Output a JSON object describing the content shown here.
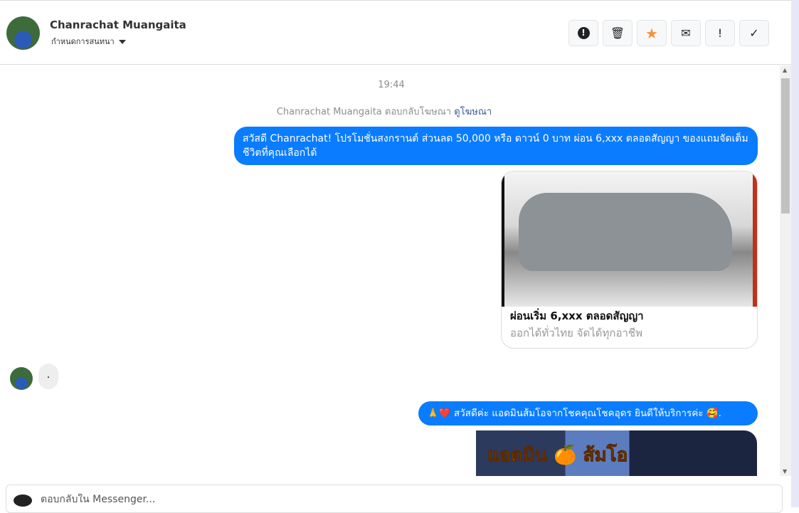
{
  "header": {
    "name": "Chanrachat Muangaita",
    "subtitle": "กำหนดการสนทนา",
    "actions": [
      {
        "icon": "alert-circle-icon",
        "glyph": "❗"
      },
      {
        "icon": "trash-icon",
        "glyph": "🗑"
      },
      {
        "icon": "star-icon",
        "glyph": "★",
        "color": "#f7923a"
      },
      {
        "icon": "envelope-icon",
        "glyph": "✉"
      },
      {
        "icon": "exclamation-icon",
        "glyph": "!"
      },
      {
        "icon": "check-icon",
        "glyph": "✓"
      }
    ]
  },
  "chat": {
    "time": "19:44",
    "ad_reply_note": "Chanrachat Muangaita ตอบกลับโฆษณา",
    "view_ad_link": "ดูโฆษณา",
    "msg1": "สวัสดี Chanrachat! โปรโมชั่นสงกรานต์ ส่วนลด 50,000 หรือ ดาวน์ 0 บาท ผ่อน 6,xxx ตลอดสัญญา ของแถมจัดเต็ม ชีวิตที่คุณเลือกได้",
    "card": {
      "title": "ผ่อนเริ่ม 6,xxx ตลอดสัญญา",
      "description": "ออกได้ทั่วไทย จัดได้ทุกอาชีพ"
    },
    "incoming": ".",
    "msg2": "🙏❤️ สวัสดีค่ะ แอดมินส้มโอจากโชคคุณโชคอุดร ยินดีให้บริการค่ะ 🥰.",
    "banner_text": "แอดมิน 🍊 ส้มโอ"
  },
  "composer": {
    "placeholder": "ตอบกลับใน Messenger..."
  },
  "colors": {
    "accent": "#0a7cff",
    "star": "#f7923a"
  }
}
